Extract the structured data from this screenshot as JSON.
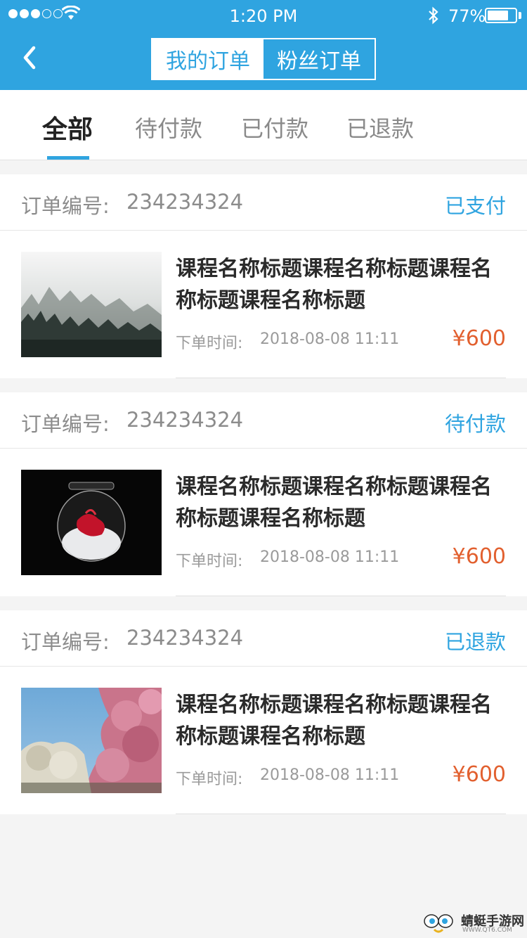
{
  "status_bar": {
    "time": "1:20 PM",
    "battery": "77%",
    "battery_level": 0.77
  },
  "nav": {
    "segments": [
      "我的订单",
      "粉丝订单"
    ],
    "active_segment": "我的订单"
  },
  "tabs": {
    "items": [
      "全部",
      "待付款",
      "已付款",
      "已退款"
    ],
    "active": "全部"
  },
  "orders": [
    {
      "label": "订单编号:",
      "number": "234234324",
      "status": "已支付",
      "title": "课程名称标题课程名称标题课程名称标题课程名称标题",
      "time_label": "下单时间:",
      "time": "2018-08-08 11:11",
      "price": "¥600",
      "image": "foggy-forest"
    },
    {
      "label": "订单编号:",
      "number": "234234324",
      "status": "待付款",
      "title": "课程名称标题课程名称标题课程名称标题课程名称标题",
      "time_label": "下单时间:",
      "time": "2018-08-08 11:11",
      "price": "¥600",
      "image": "glass-jar"
    },
    {
      "label": "订单编号:",
      "number": "234234324",
      "status": "已退款",
      "title": "课程名称标题课程名称标题课程名称标题课程名称标题",
      "time_label": "下单时间:",
      "time": "2018-08-08 11:11",
      "price": "¥600",
      "image": "cherry-blossom"
    }
  ],
  "watermark": {
    "text": "蜻蜓手游网",
    "sub": "WWW.QT6.COM"
  },
  "colors": {
    "primary": "#2fa4e0",
    "price": "#e2602f"
  },
  "icons": [
    "signal-icon",
    "wifi-icon",
    "bluetooth-icon",
    "battery-icon",
    "back-icon"
  ]
}
